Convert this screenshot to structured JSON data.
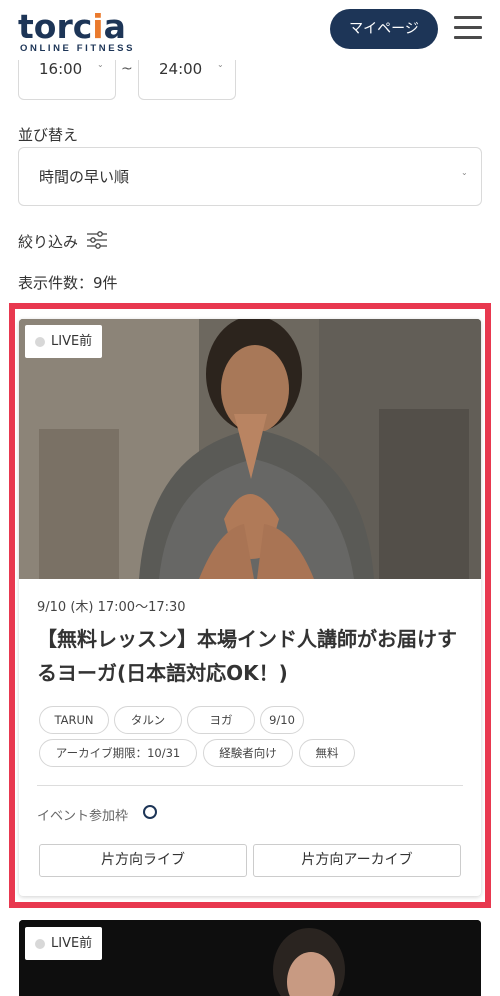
{
  "header": {
    "logo_text_main": "torc",
    "logo_text_accent": "i",
    "logo_text_end": "a",
    "logo_subtitle": "ONLINE FITNESS",
    "mypage_label": "マイページ",
    "menu_icon": "hamburger-icon"
  },
  "filters": {
    "time_from": "16:00",
    "time_separator": "~",
    "time_to": "24:00",
    "sort_label": "並び替え",
    "sort_value": "時間の早い順",
    "filter_label": "絞り込み",
    "filter_icon": "sliders-icon",
    "result_count": "表示件数：9件"
  },
  "cards": [
    {
      "badge": "LIVE前",
      "datetime": "9/10 (木) 17:00〜17:30",
      "title": "【無料レッスン】本場インド人講師がお届けするヨーガ(日本語対応OK！)",
      "tags": [
        "TARUN",
        "タルン",
        "ヨガ",
        "9/10",
        "アーカイブ期限：10/31",
        "経験者向け",
        "無料"
      ],
      "capacity_label": "イベント参加枠",
      "capacity_icon": "circle-available-icon",
      "buttons": [
        "片方向ライブ",
        "片方向アーカイブ"
      ]
    },
    {
      "badge": "LIVE前"
    }
  ],
  "colors": {
    "brand_navy": "#1d3557",
    "brand_orange": "#ea7a2d",
    "highlight_red": "#e8384f"
  }
}
